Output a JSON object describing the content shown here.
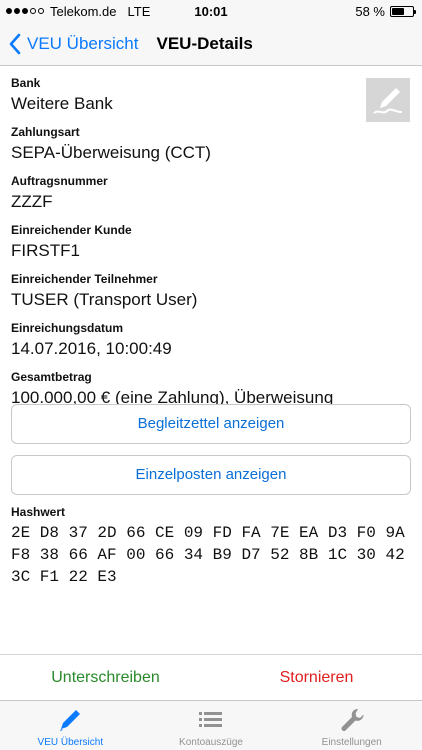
{
  "status_bar": {
    "carrier": "Telekom.de",
    "network": "LTE",
    "time": "10:01",
    "battery_text": "58 %",
    "battery_level": 0.58
  },
  "nav": {
    "back_label": "VEU Übersicht",
    "title": "VEU-Details"
  },
  "fields": [
    {
      "label": "Bank",
      "value": "Weitere Bank"
    },
    {
      "label": "Zahlungsart",
      "value": "SEPA-Überweisung (CCT)"
    },
    {
      "label": "Auftragsnummer",
      "value": "ZZZF"
    },
    {
      "label": "Einreichender Kunde",
      "value": "FIRSTF1"
    },
    {
      "label": "Einreichender Teilnehmer",
      "value": "TUSER (Transport User)"
    },
    {
      "label": "Einreichungsdatum",
      "value": "14.07.2016, 10:00:49"
    },
    {
      "label": "Gesamtbetrag",
      "value": "100.000,00 € (eine Zahlung), Überweisung"
    }
  ],
  "buttons": {
    "begleitzettel": "Begleitzettel anzeigen",
    "einzelposten": "Einzelposten anzeigen"
  },
  "hash": {
    "label": "Hashwert",
    "value": "2E D8 37 2D 66 CE 09 FD FA 7E EA D3 F0 9A F8 38 66 AF 00 66 34 B9 D7 52 8B 1C 30 42 3C F1 22 E3"
  },
  "actions": {
    "sign": "Unterschreiben",
    "cancel": "Stornieren"
  },
  "tabs": [
    {
      "label": "VEU Übersicht",
      "icon": "pen-icon",
      "active": true
    },
    {
      "label": "Kontoauszüge",
      "icon": "list-icon",
      "active": false
    },
    {
      "label": "Einstellungen",
      "icon": "wrench-icon",
      "active": false
    }
  ],
  "colors": {
    "accent": "#0a7aff",
    "sign": "#2a8a2a",
    "cancel": "#e0201e"
  }
}
